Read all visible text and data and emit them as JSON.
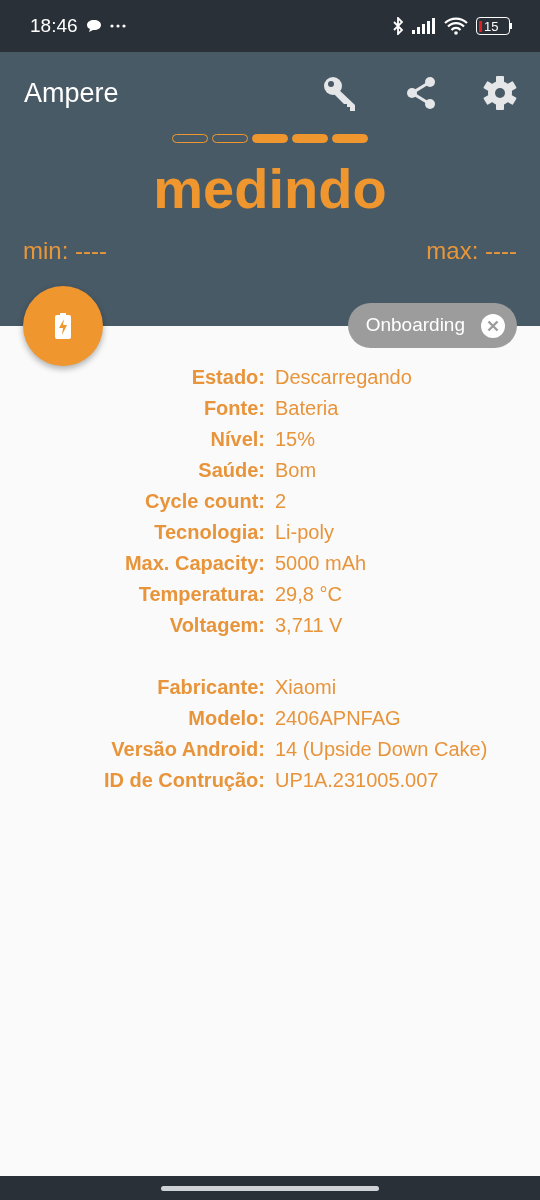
{
  "status_bar": {
    "time": "18:46",
    "battery": "15"
  },
  "app_bar": {
    "title": "Ampere"
  },
  "indicators": [
    {
      "filled": false
    },
    {
      "filled": false
    },
    {
      "filled": true
    },
    {
      "filled": true
    },
    {
      "filled": true
    }
  ],
  "status_text": "medindo",
  "min": "min: ----",
  "max": "max: ----",
  "chip": {
    "label": "Onboarding"
  },
  "groups": [
    {
      "rows": [
        {
          "label": "Estado:",
          "value": "Descarregando"
        },
        {
          "label": "Fonte:",
          "value": "Bateria"
        },
        {
          "label": "Nível:",
          "value": "15%"
        },
        {
          "label": "Saúde:",
          "value": "Bom"
        },
        {
          "label": "Cycle count:",
          "value": "2"
        },
        {
          "label": "Tecnologia:",
          "value": "Li-poly"
        },
        {
          "label": "Max. Capacity:",
          "value": "5000 mAh"
        },
        {
          "label": "Temperatura:",
          "value": "29,8 °C"
        },
        {
          "label": "Voltagem:",
          "value": "3,711 V"
        }
      ]
    },
    {
      "rows": [
        {
          "label": "Fabricante:",
          "value": "Xiaomi"
        },
        {
          "label": "Modelo:",
          "value": "2406APNFAG"
        },
        {
          "label": "Versão Android:",
          "value": "14 (Upside Down Cake)"
        },
        {
          "label": "ID de Contrução:",
          "value": "UP1A.231005.007"
        }
      ]
    }
  ]
}
